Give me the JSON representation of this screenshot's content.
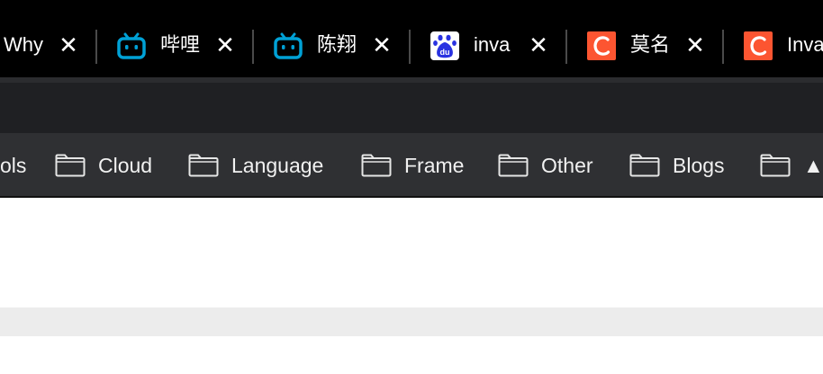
{
  "tabs": [
    {
      "title": "Why",
      "favicon": "none"
    },
    {
      "title": "哔哩",
      "favicon": "bilibili-icon"
    },
    {
      "title": "陈翔",
      "favicon": "bilibili-icon"
    },
    {
      "title": "inva",
      "favicon": "baidu-icon"
    },
    {
      "title": "莫名",
      "favicon": "csdn-icon"
    },
    {
      "title": "Inva",
      "favicon": "csdn-icon"
    }
  ],
  "tab_close_glyph": "✕",
  "bookmarks": [
    {
      "label": "ols"
    },
    {
      "label": "Cloud"
    },
    {
      "label": "Language"
    },
    {
      "label": "Frame"
    },
    {
      "label": "Other"
    },
    {
      "label": "Blogs"
    },
    {
      "label": "▲S"
    }
  ],
  "colors": {
    "tabbar": "#000000",
    "toolbar": "#1f2023",
    "bookmarks_bar": "#2f3033",
    "bilibili": "#00a1d6",
    "baidu": "#2932e1",
    "csdn": "#fc5531"
  }
}
